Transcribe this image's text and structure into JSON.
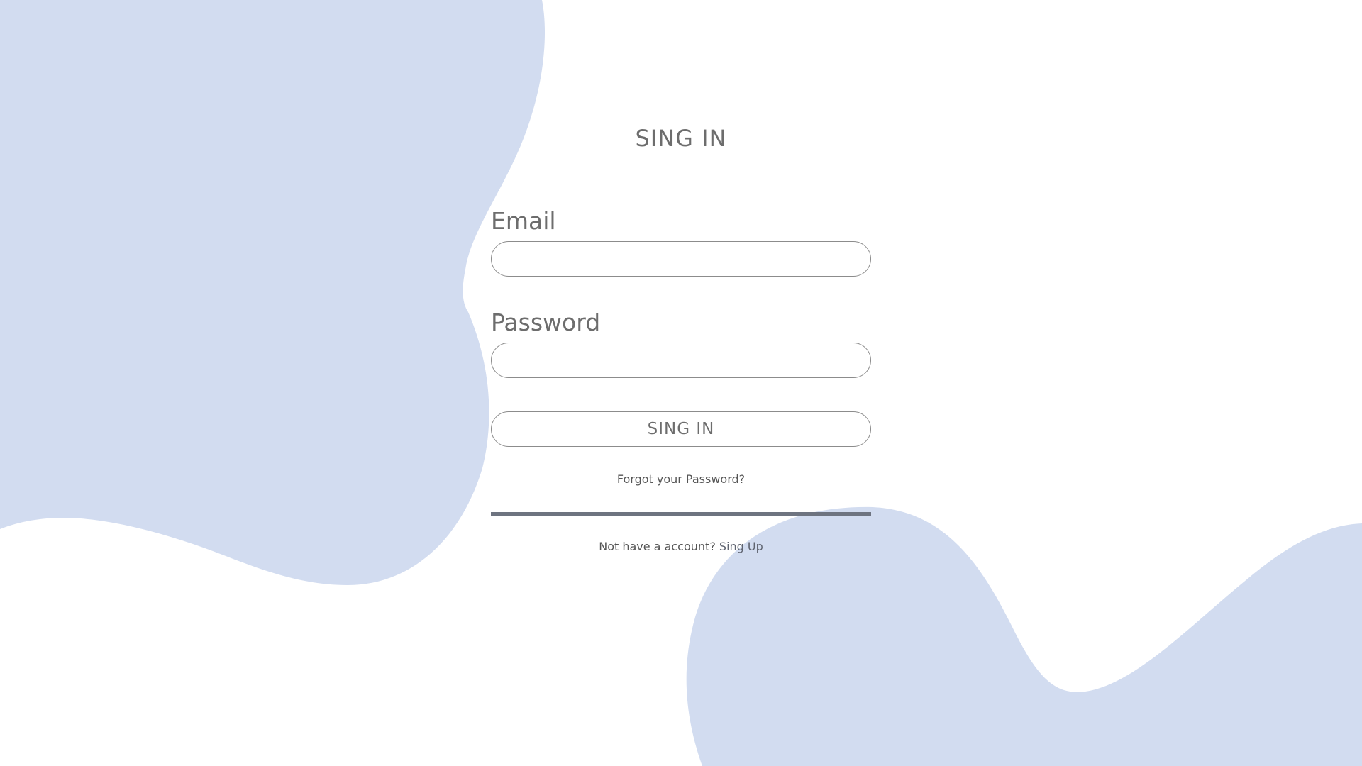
{
  "title": "SING IN",
  "form": {
    "email_label": "Email",
    "email_value": "",
    "password_label": "Password",
    "password_value": "",
    "submit_label": "SING IN"
  },
  "links": {
    "forgot_password": "Forgot your Password?",
    "no_account_text": "Not have a account?",
    "signup_label": "Sing Up"
  },
  "colors": {
    "background": "#ffffff",
    "blob": "#d2dcf0",
    "text": "#6d6d6d",
    "divider": "#6e7480"
  }
}
